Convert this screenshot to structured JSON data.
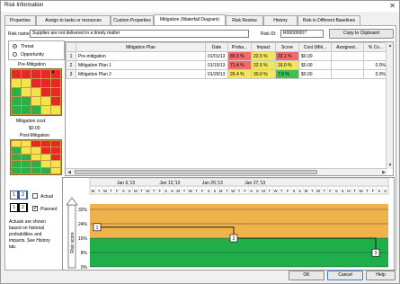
{
  "window": {
    "title": "Risk Information"
  },
  "tabs": [
    {
      "label": "Properties"
    },
    {
      "label": "Assign to tasks or resources"
    },
    {
      "label": "Custom Properties"
    },
    {
      "label": "Mitigation (Waterfall Diagram)"
    },
    {
      "label": "Risk Review"
    },
    {
      "label": "History"
    },
    {
      "label": "Risk in Different Baselines"
    }
  ],
  "header": {
    "risk_name_label": "Risk name:",
    "risk_name_value": "Supplies are not delivered in a timely matter",
    "risk_id_label": "Risk ID:",
    "risk_id_value": "R00000007",
    "copy_button": "Copy to Clipboard"
  },
  "left": {
    "threat_label": "Threat",
    "opportunity_label": "Opportunity",
    "threat_selected": true,
    "pre_label": "Pre-Mitigation",
    "cost_label": "Mitigation cost:",
    "cost_value": "$0.00",
    "post_label": "Post-Mitigation"
  },
  "matrix_colors": {
    "pre": [
      "r",
      "r",
      "r",
      "r",
      "r",
      "y",
      "y",
      "r",
      "r",
      "r",
      "g",
      "y",
      "y",
      "r",
      "r",
      "g",
      "g",
      "y",
      "y",
      "r",
      "g",
      "g",
      "g",
      "y",
      "y"
    ],
    "post": [
      "y",
      "y",
      "r",
      "r",
      "r",
      "g",
      "y",
      "y",
      "r",
      "r",
      "g",
      "g",
      "y",
      "y",
      "r",
      "g",
      "g",
      "g",
      "y",
      "y",
      "g",
      "g",
      "g",
      "g",
      "y"
    ]
  },
  "table": {
    "columns": [
      "Mitigation Plan",
      "Date",
      "Proba...",
      "Impact",
      "Score",
      "Cost (Miti...",
      "Assigned...",
      "% Co..."
    ],
    "rows": [
      {
        "num": "1",
        "plan": "Pre-mitigation",
        "date": "01/01/13",
        "prob": "80.3 %",
        "impact": "22.5 %",
        "score": "22.1 %",
        "cost": "$0.00",
        "assigned": "",
        "pct": ""
      },
      {
        "num": "2",
        "plan": "Mitigation Plan 1",
        "date": "01/15/13",
        "prob": "71.4 %",
        "impact": "22.5 %",
        "score": "16.0 %",
        "cost": "$0.00",
        "assigned": "",
        "pct": "0.0%"
      },
      {
        "num": "3",
        "plan": "Mitigation Plan 2",
        "date": "01/29/13",
        "prob": "26.4 %",
        "impact": "30.0 %",
        "score": "7.9 %",
        "cost": "$0.00",
        "assigned": "",
        "pct": "0.0%"
      }
    ]
  },
  "legend": {
    "actual_label": "Actual",
    "planned_label": "Planned",
    "planned_checked": true,
    "actual_checked": false,
    "actual_nums": [
      "1",
      "2"
    ],
    "planned_nums": [
      "1",
      "2"
    ],
    "note": "Actuals are shown based on historial probabilities and impacts. See History tab."
  },
  "chart": {
    "weeks": [
      "Jan 6,'13",
      "Jan 13,'13",
      "Jan 20,'13",
      "Jan 27,'13"
    ],
    "days": [
      "M",
      "T",
      "W",
      "T",
      "F",
      "S",
      "S",
      "M",
      "T",
      "W",
      "T",
      "F",
      "S",
      "S",
      "M",
      "T",
      "W",
      "T",
      "F",
      "S",
      "S",
      "M",
      "T",
      "W",
      "T",
      "F",
      "S",
      "S",
      "M",
      "T",
      "W",
      "T",
      "F",
      "S",
      "S",
      "M",
      "T",
      "W",
      "T",
      "F",
      "S",
      "S",
      "M",
      "T",
      "W",
      "T",
      "F",
      "S",
      "S"
    ],
    "yticks": [
      "32%",
      "24%",
      "16%",
      "8%",
      "0%"
    ],
    "ylabel": "Risk score",
    "markers": [
      "1",
      "2",
      "3"
    ]
  },
  "chart_data": {
    "type": "line",
    "ylabel": "Risk score",
    "ylim": [
      0,
      35
    ],
    "yticks": [
      0,
      8,
      16,
      24,
      32
    ],
    "x": [
      "01/01/13",
      "01/15/13",
      "01/29/13"
    ],
    "series": [
      {
        "values": [
          22.1,
          16.0,
          7.9
        ]
      }
    ]
  },
  "footer": {
    "ok": "OK",
    "cancel": "Cancel",
    "help": "Help"
  }
}
